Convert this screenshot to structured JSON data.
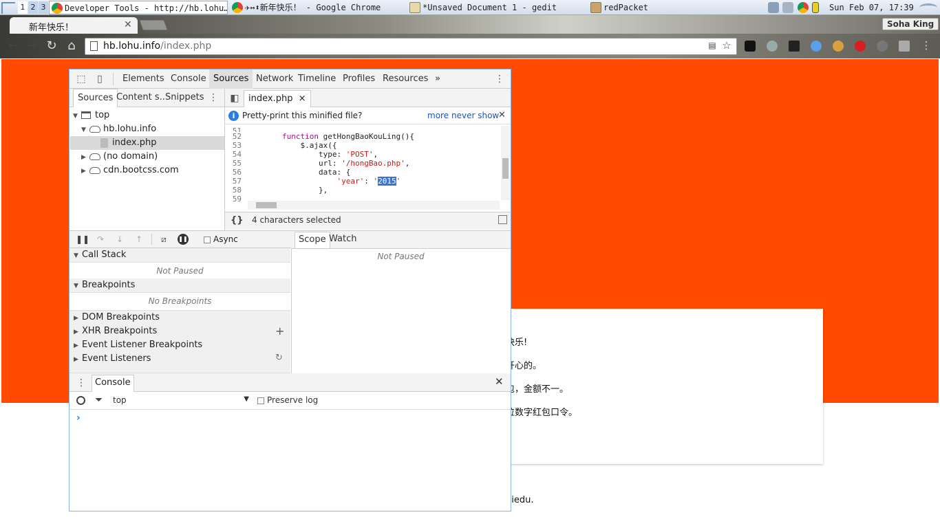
{
  "taskbar": {
    "workspaces": [
      "1",
      "2",
      "3"
    ],
    "tasks": [
      {
        "label": "Developer Tools - http://hb.lohu…",
        "icon": "chrome-icon"
      },
      {
        "label": "✈↔⬍新年快乐！ - Google Chrome",
        "icon": "chrome-icon"
      },
      {
        "label": "*Unsaved Document 1 - gedit",
        "icon": "gedit-icon"
      },
      {
        "label": "redPacket",
        "icon": "folder-icon"
      }
    ],
    "clock": "Sun Feb 07, 17:39"
  },
  "browser": {
    "tab_title": "新年快乐！",
    "profile_name": "Soha King",
    "url_host": "hb.lohu.info",
    "url_path": "/index.php"
  },
  "page": {
    "card_lines": [
      "快乐!",
      "开心的。",
      "包，金额不一。",
      "位数字红包口令。"
    ],
    "footer_text": "piedu."
  },
  "devtools": {
    "panels": [
      "Elements",
      "Console",
      "Sources",
      "Network",
      "Timeline",
      "Profiles",
      "Resources"
    ],
    "more_panels": "»",
    "navigator_tabs": [
      "Sources",
      "Content s..",
      "Snippets"
    ],
    "tree": {
      "top": "top",
      "host": "hb.lohu.info",
      "file": "index.php",
      "no_domain": "(no domain)",
      "cdn": "cdn.bootcss.com"
    },
    "editor_tab": "index.php",
    "infobar": {
      "message": "Pretty-print this minified file?",
      "more": "more",
      "never_show": "never show"
    },
    "code_lines": [
      {
        "n": "51",
        "text": ""
      },
      {
        "n": "52",
        "text": "        function getHongBaoKouLing(){"
      },
      {
        "n": "53",
        "text": "            $.ajax({"
      },
      {
        "n": "54",
        "text": "                type: 'POST',"
      },
      {
        "n": "55",
        "text": "                url: '/hongBao.php',"
      },
      {
        "n": "56",
        "text": "                data: {"
      },
      {
        "n": "57",
        "text": "                    'year': '2015'"
      },
      {
        "n": "58",
        "text": "                },"
      },
      {
        "n": "59",
        "text": ""
      }
    ],
    "status": "4 characters selected",
    "pretty_print_label": "{}",
    "debugger": {
      "async_label": "Async",
      "call_stack": "Call Stack",
      "not_paused": "Not Paused",
      "breakpoints": "Breakpoints",
      "no_breakpoints": "No Breakpoints",
      "dom_breakpoints": "DOM Breakpoints",
      "xhr_breakpoints": "XHR Breakpoints",
      "event_listener_breakpoints": "Event Listener Breakpoints",
      "event_listeners": "Event Listeners"
    },
    "scope_tabs": [
      "Scope",
      "Watch"
    ],
    "scope_not_paused": "Not Paused",
    "console": {
      "title": "Console",
      "context": "top",
      "preserve_log": "Preserve log",
      "prompt": "›"
    }
  },
  "colors": {
    "page_accent": "#ff4a00",
    "link": "#1155cc",
    "selection": "#3875d7"
  }
}
